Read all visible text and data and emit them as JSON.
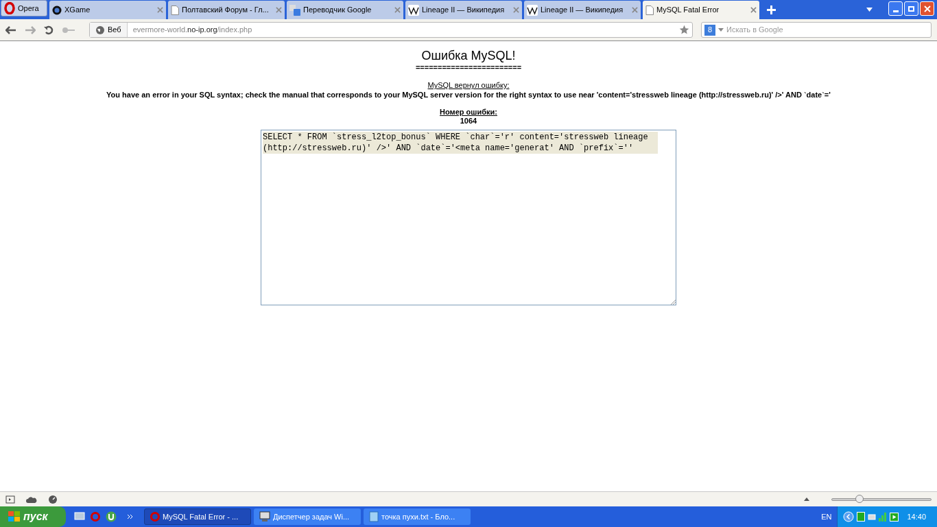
{
  "browser": {
    "menu_button": "Opera",
    "tabs": [
      {
        "label": "XGame",
        "kind": "disc",
        "selected": false
      },
      {
        "label": "Полтавский Форум - Гл...",
        "kind": "page",
        "selected": false
      },
      {
        "label": "Переводчик Google",
        "kind": "translate",
        "selected": false
      },
      {
        "label": "Lineage II — Википедия",
        "kind": "wiki",
        "selected": false
      },
      {
        "label": "Lineage II — Википедия",
        "kind": "wiki",
        "selected": false
      },
      {
        "label": "MySQL Fatal Error",
        "kind": "page",
        "selected": true
      }
    ],
    "address": {
      "badge": "Веб",
      "url_host_prefix": "evermore-world.",
      "url_host": "no-ip.org",
      "url_path": "/index.php"
    },
    "search": {
      "engine": "8",
      "placeholder": "Искать в Google"
    }
  },
  "page": {
    "title": "Ошибка MySQL!",
    "rule": "========================",
    "error_label": "MySQL вернул ошибку:",
    "error_message": "You have an error in your SQL syntax; check the manual that corresponds to your MySQL server version for the right syntax to use near 'content='stressweb lineage (http://stressweb.ru)' />' AND `date`='",
    "code_label": "Номер ошибки:",
    "code": "1064",
    "query": "SELECT * FROM `stress_l2top_bonus` WHERE `char`='r' content='stressweb lineage (http://stressweb.ru)' />' AND `date`='<meta name='generat' AND `prefix`=''"
  },
  "status_bar": {
    "zoom": {
      "level": 0.28
    }
  },
  "taskbar": {
    "start": "пуск",
    "items": [
      {
        "label": "MySQL Fatal Error - ...",
        "kind": "opera",
        "selected": true
      },
      {
        "label": "Диспетчер задач Wi...",
        "kind": "monitor",
        "selected": false
      },
      {
        "label": "точка пухи.txt - Бло...",
        "kind": "notepad",
        "selected": false
      }
    ],
    "lang": "EN",
    "clock": "14:40"
  }
}
